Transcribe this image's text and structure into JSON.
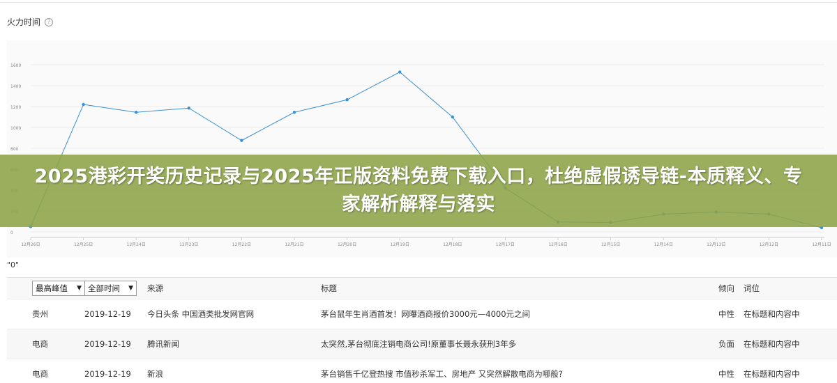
{
  "section": {
    "title": "火力时间",
    "help_icon": "question-circle-icon"
  },
  "quote_label": "\"0\"",
  "chart_data": {
    "type": "line",
    "x": [
      "12月26日",
      "12月25日",
      "12月24日",
      "12月23日",
      "12月22日",
      "12月21日",
      "12月20日",
      "12月19日",
      "12月18日",
      "12月17日",
      "12月16日",
      "12月15日",
      "12月14日",
      "12月13日",
      "12月12日",
      "12月11日"
    ],
    "series": [
      {
        "values": [
          50,
          1220,
          1145,
          1185,
          875,
          1145,
          1265,
          1530,
          1100,
          420,
          95,
          90,
          170,
          190,
          170,
          40
        ]
      }
    ],
    "yticks": [
      0,
      200,
      400,
      600,
      800,
      1000,
      1200,
      1400,
      1600
    ],
    "ylim": [
      0,
      1700
    ],
    "grid": true,
    "color": "#3a8fd0"
  },
  "table": {
    "filter1": "最高峰值",
    "filter2": "全部时间",
    "headers": {
      "source": "来源",
      "title": "标题",
      "tendency": "倾向",
      "keyword": "词位"
    },
    "rows": [
      {
        "region": "贵州",
        "date": "2019-12-19",
        "source": "今日头条 中国酒类批发网官网",
        "title": "茅台鼠年生肖酒首发！网曝酒商报价3000元—4000元之间",
        "tendency": "中性",
        "keyword": "在标题和内容中"
      },
      {
        "region": "电商",
        "date": "2019-12-19",
        "source": "腾讯新闻",
        "title": "太突然,茅台彻底注销电商公司!原董事长聂永获刑3年多",
        "tendency": "负面",
        "keyword": "在标题和内容中"
      },
      {
        "region": "电商",
        "date": "2019-12-19",
        "source": "新浪",
        "title": "茅台销售千亿登热搜 市值秒杀军工、房地产 又突然解散电商为哪般?",
        "tendency": "中性",
        "keyword": "在标题和内容中"
      }
    ]
  },
  "banner": {
    "text": "2025港彩开奖历史记录与2025年正版资料免费下载入口，杜绝虚假诱导链-本质释义、专家解析解释与落实"
  }
}
